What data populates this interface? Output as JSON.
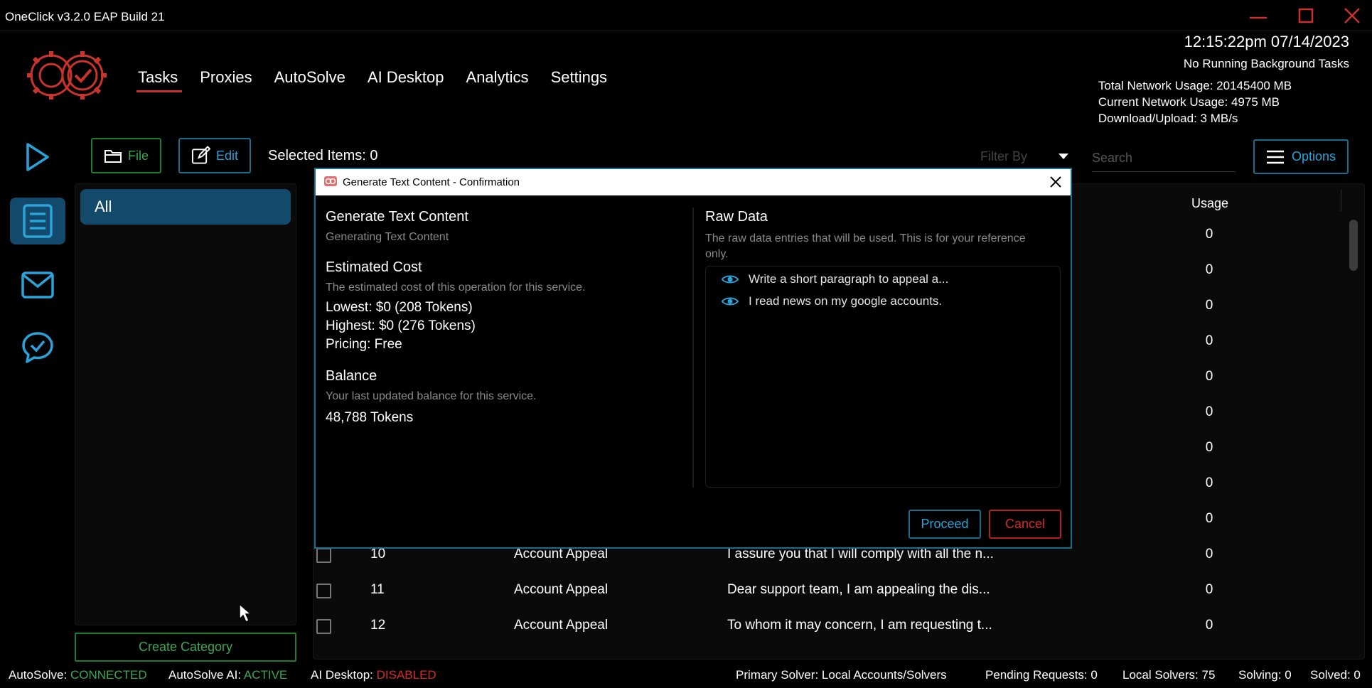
{
  "window": {
    "title": "OneClick v3.2.0 EAP Build 21"
  },
  "nav": {
    "items": [
      {
        "label": "Tasks",
        "active": true
      },
      {
        "label": "Proxies"
      },
      {
        "label": "AutoSolve"
      },
      {
        "label": "AI Desktop"
      },
      {
        "label": "Analytics"
      },
      {
        "label": "Settings"
      }
    ]
  },
  "info": {
    "clock": "12:15:22pm 07/14/2023",
    "background": "No Running Background Tasks",
    "total_network": "Total Network Usage:  20145400 MB",
    "current_network": "Current Network Usage: 4975 MB",
    "download_upload": "Download/Upload: 3 MB/s"
  },
  "toolbar": {
    "file_label": "File",
    "edit_label": "Edit",
    "selected": "Selected Items: 0",
    "filter_label": "Filter By",
    "search_placeholder": "Search",
    "options_label": "Options"
  },
  "categories": {
    "all_label": "All",
    "create_label": "Create Category"
  },
  "table": {
    "usage_header": "Usage",
    "hidden_usage": [
      "0",
      "0",
      "0",
      "0",
      "0",
      "0",
      "0",
      "0",
      "0"
    ],
    "rows": [
      {
        "num": "10",
        "type": "Account Appeal",
        "content": "I assure you that I will comply with all the n...",
        "usage": "0"
      },
      {
        "num": "11",
        "type": "Account Appeal",
        "content": "Dear support team, I am appealing the dis...",
        "usage": "0"
      },
      {
        "num": "12",
        "type": "Account Appeal",
        "content": "To whom it may concern, I am requesting t...",
        "usage": "0"
      }
    ]
  },
  "modal": {
    "title": "Generate Text Content - Confirmation",
    "heading": "Generate Text Content",
    "subheading": "Generating Text Content",
    "cost_heading": "Estimated Cost",
    "cost_desc": "The estimated cost of this operation for this service.",
    "lowest": "Lowest: $0 (208 Tokens)",
    "highest": "Highest: $0 (276 Tokens)",
    "pricing": "Pricing: Free",
    "balance_heading": "Balance",
    "balance_desc": "Your last updated balance for this service.",
    "balance_value": "48,788 Tokens",
    "raw_heading": "Raw Data",
    "raw_desc": "The raw data entries that will be used. This is for your reference only.",
    "raw_items": [
      "Write a short paragraph to appeal a...",
      "I read news on my google accounts."
    ],
    "proceed_label": "Proceed",
    "cancel_label": "Cancel"
  },
  "status": {
    "autosolve_label": "AutoSolve:",
    "autosolve_value": "CONNECTED",
    "autosolve_ai_label": "AutoSolve AI:",
    "autosolve_ai_value": "ACTIVE",
    "ai_desktop_label": "AI Desktop:",
    "ai_desktop_value": "DISABLED",
    "primary_solver": "Primary Solver: Local Accounts/Solvers",
    "pending": "Pending Requests: 0",
    "local_solvers": "Local Solvers: 75",
    "solving": "Solving: 0",
    "solved": "Solved: 0"
  },
  "colors": {
    "accent_blue": "#2aa3d9",
    "accent_green": "#3aa84f",
    "accent_red": "#c9332b",
    "active_bg": "#134a6b"
  }
}
